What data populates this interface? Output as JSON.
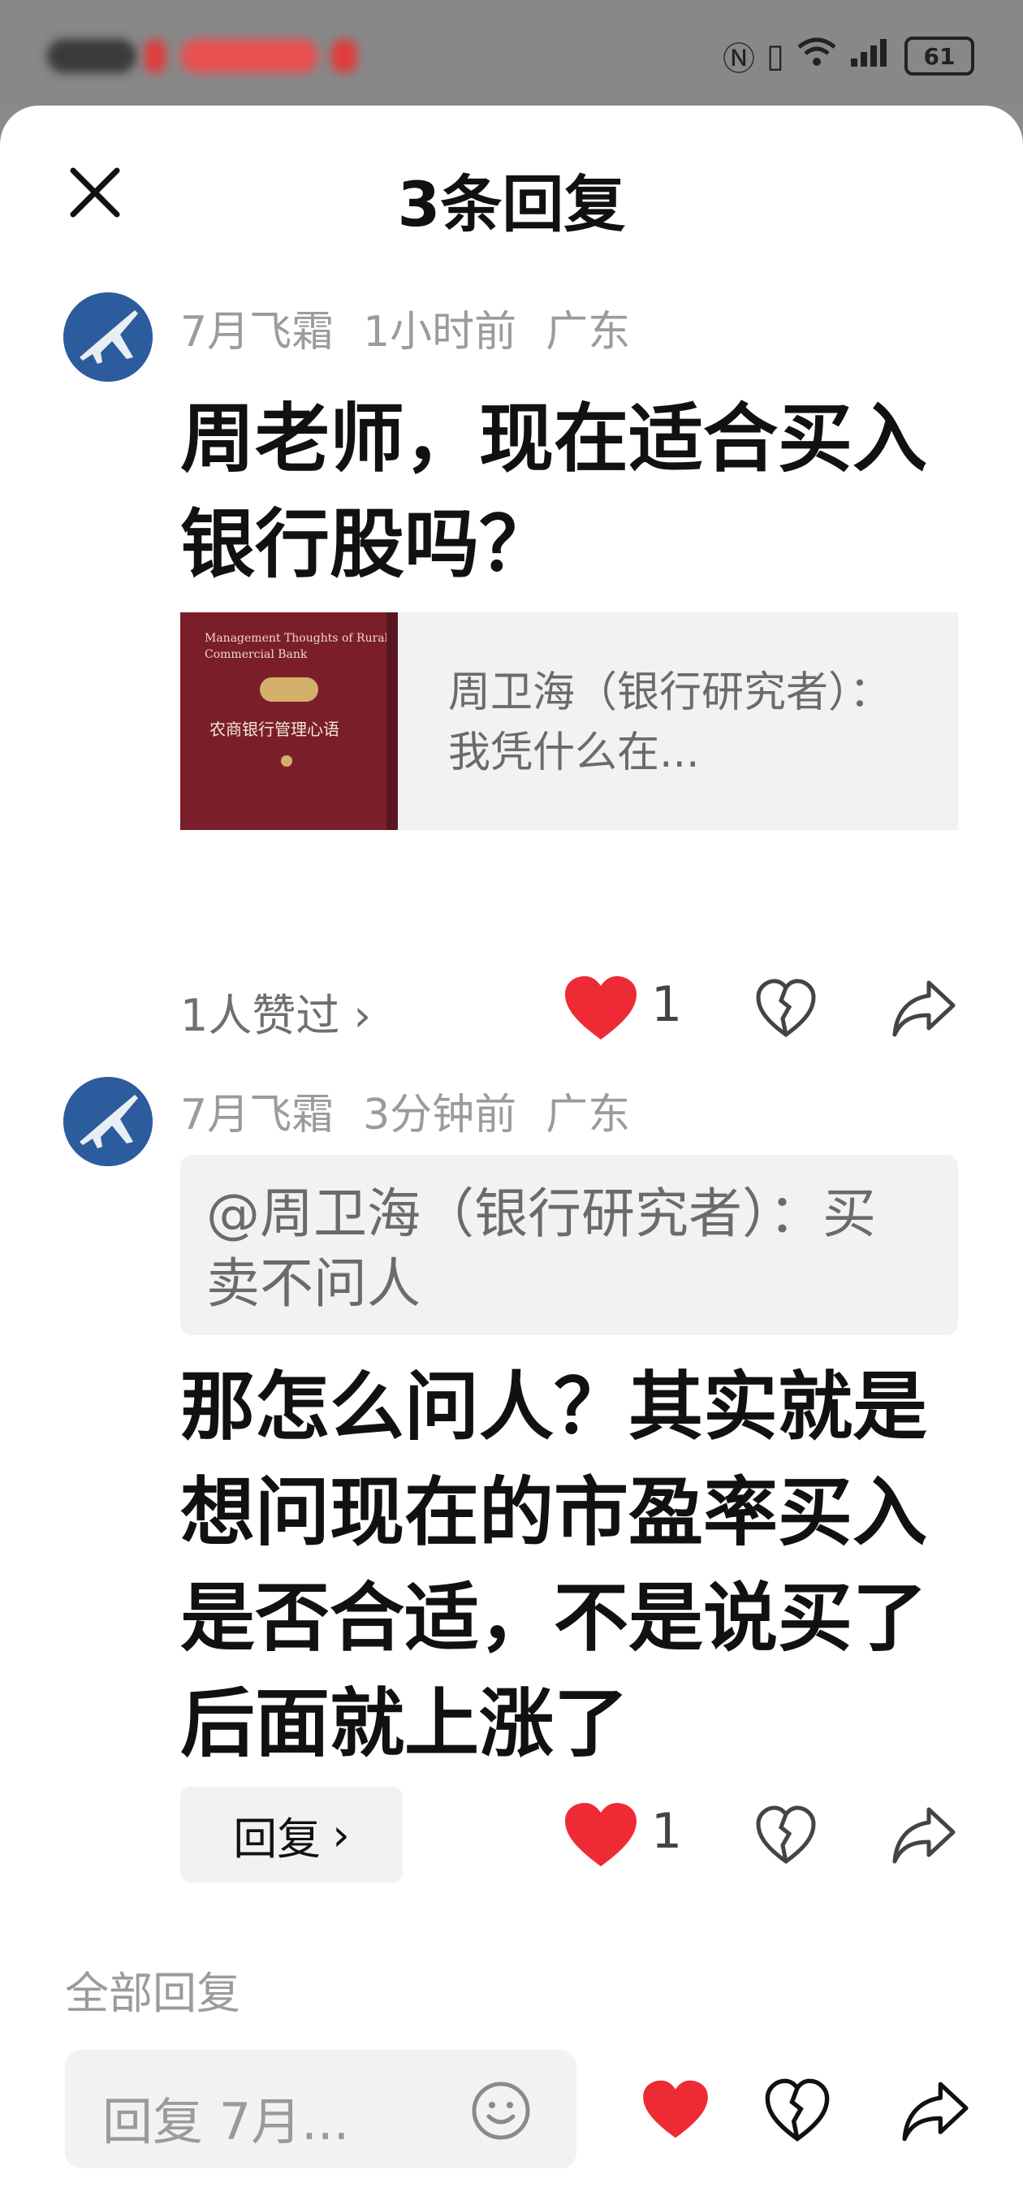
{
  "status_bar": {
    "battery": "61"
  },
  "sheet": {
    "title": "3条回复"
  },
  "comments": [
    {
      "author": "7月飞霜",
      "time": "1小时前",
      "location": "广东",
      "text": "周老师，现在适合买入银行股吗？",
      "quote_card": {
        "book_cover_title_en": "Management Thoughts of Rural Commercial Bank",
        "book_cover_title_cn": "农商银行管理心语",
        "text": "周卫海（银行研究者）：我凭什么在..."
      },
      "liked_by": "1人赞过",
      "like_count": "1"
    },
    {
      "author": "7月飞霜",
      "time": "3分钟前",
      "location": "广东",
      "reply_to": "@周卫海（银行研究者）：买卖不问人",
      "text": "那怎么问人？其实就是想问现在的市盈率买入是否合适，不是说买了后面就上涨了",
      "reply_label": "回复",
      "like_count": "1"
    }
  ],
  "all_replies_label": "全部回复",
  "bottom_bar": {
    "input_placeholder": "回复 7月..."
  },
  "icons": {
    "close": "close-icon",
    "heart": "heart-icon",
    "broken_heart": "broken-heart-icon",
    "share": "share-icon",
    "emoji": "emoji-icon",
    "chevron": "chevron-right-icon"
  },
  "colors": {
    "like_red": "#ee2b35",
    "muted": "#9b9b9b",
    "card_bg": "#f1f2f4"
  }
}
